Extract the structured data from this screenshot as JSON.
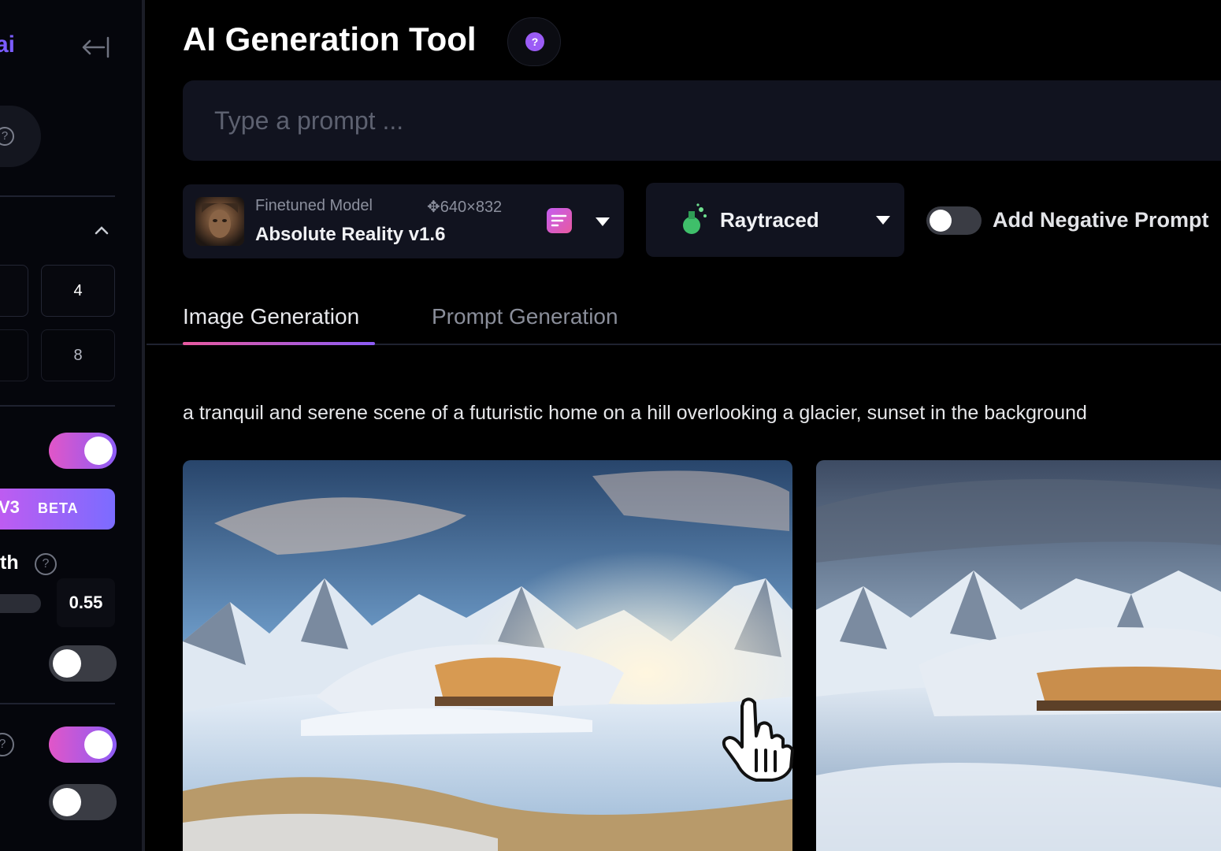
{
  "sidebar": {
    "brand": "ai",
    "num_boxes": [
      "4",
      "8"
    ],
    "beta_button": {
      "version": "V3",
      "badge": "BETA"
    },
    "strength_label": "th",
    "strength_value": "0.55",
    "toggles": {
      "first": true,
      "second": false,
      "third": true,
      "fourth": false
    }
  },
  "header": {
    "title": "AI Generation Tool"
  },
  "prompt": {
    "placeholder": "Type a prompt ..."
  },
  "model": {
    "kind": "Finetuned Model",
    "dimensions": "640×832",
    "name": "Absolute Reality v1.6"
  },
  "style": {
    "label": "Raytraced"
  },
  "negative_prompt": {
    "label": "Add Negative Prompt",
    "enabled": false
  },
  "tabs": [
    {
      "label": "Image Generation",
      "active": true
    },
    {
      "label": "Prompt Generation",
      "active": false
    }
  ],
  "generation": {
    "prompt_text": "a tranquil and serene scene of a futuristic home on a hill overlooking a glacier, sunset in the background"
  },
  "colors": {
    "accent_purple": "#8c5cf6",
    "accent_pink": "#e156c8",
    "panel": "#11131f"
  }
}
